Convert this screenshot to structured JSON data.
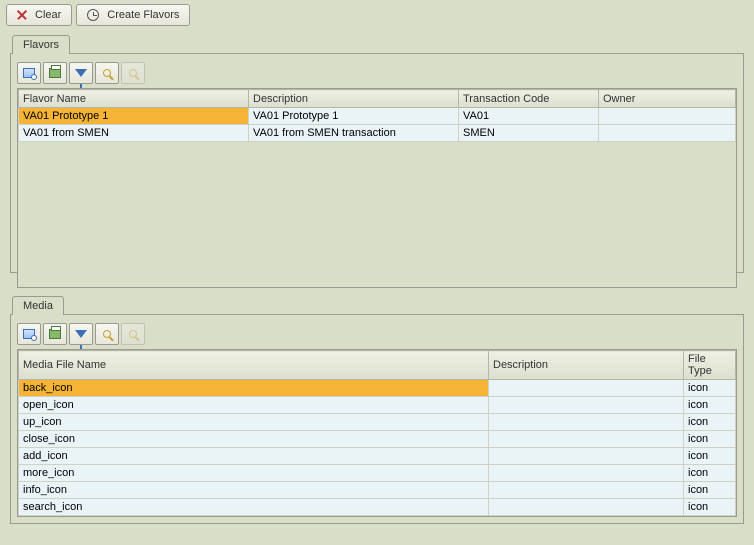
{
  "toolbar": {
    "clear_label": "Clear",
    "create_label": "Create Flavors"
  },
  "flavors_panel": {
    "title": "Flavors",
    "columns": {
      "name": "Flavor Name",
      "desc": "Description",
      "tcode": "Transaction Code",
      "owner": "Owner"
    },
    "rows": [
      {
        "name": "VA01 Prototype 1",
        "desc": "VA01 Prototype 1",
        "tcode": "VA01",
        "owner": ""
      },
      {
        "name": "VA01 from SMEN",
        "desc": "VA01 from SMEN transaction",
        "tcode": "SMEN",
        "owner": ""
      }
    ]
  },
  "media_panel": {
    "title": "Media",
    "columns": {
      "name": "Media File Name",
      "desc": "Description",
      "type": "File Type"
    },
    "rows": [
      {
        "name": "back_icon",
        "desc": "",
        "type": "icon"
      },
      {
        "name": "open_icon",
        "desc": "",
        "type": "icon"
      },
      {
        "name": "up_icon",
        "desc": "",
        "type": "icon"
      },
      {
        "name": "close_icon",
        "desc": "",
        "type": "icon"
      },
      {
        "name": "add_icon",
        "desc": "",
        "type": "icon"
      },
      {
        "name": "more_icon",
        "desc": "",
        "type": "icon"
      },
      {
        "name": "info_icon",
        "desc": "",
        "type": "icon"
      },
      {
        "name": "search_icon",
        "desc": "",
        "type": "icon"
      }
    ]
  }
}
